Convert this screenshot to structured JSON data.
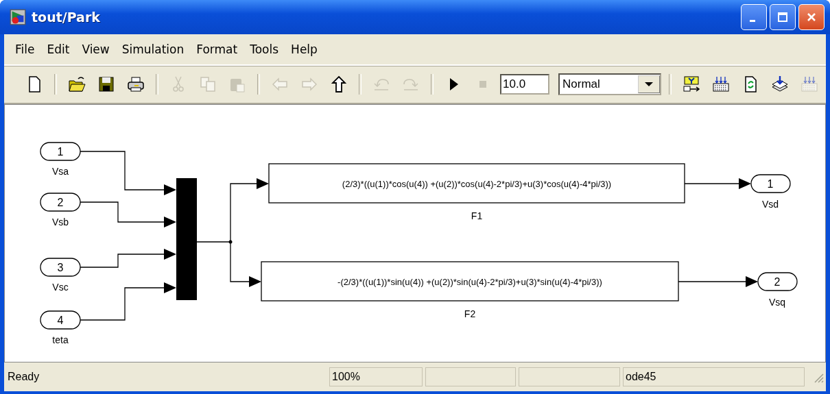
{
  "window": {
    "title": "tout/Park"
  },
  "menu": [
    "File",
    "Edit",
    "View",
    "Simulation",
    "Format",
    "Tools",
    "Help"
  ],
  "toolbar": [
    {
      "kind": "new",
      "disabled": false
    },
    {
      "kind": "separator"
    },
    {
      "kind": "open",
      "disabled": false
    },
    {
      "kind": "save",
      "disabled": false
    },
    {
      "kind": "print",
      "disabled": false
    },
    {
      "kind": "separator"
    },
    {
      "kind": "cut",
      "disabled": true
    },
    {
      "kind": "copy",
      "disabled": true
    },
    {
      "kind": "paste",
      "disabled": true
    },
    {
      "kind": "separator"
    },
    {
      "kind": "back",
      "disabled": true
    },
    {
      "kind": "forward",
      "disabled": true
    },
    {
      "kind": "up",
      "disabled": false
    },
    {
      "kind": "separator"
    },
    {
      "kind": "undo",
      "disabled": true
    },
    {
      "kind": "redo",
      "disabled": true
    },
    {
      "kind": "separator"
    },
    {
      "kind": "start",
      "disabled": false
    },
    {
      "kind": "stop",
      "disabled": true
    },
    {
      "kind": "stoptime",
      "value": "10.0"
    },
    {
      "kind": "mode",
      "value": "Normal"
    },
    {
      "kind": "separator"
    },
    {
      "kind": "scope",
      "disabled": false
    },
    {
      "kind": "grid",
      "disabled": false
    },
    {
      "kind": "refresh",
      "disabled": false
    },
    {
      "kind": "layers",
      "disabled": false
    },
    {
      "kind": "grid",
      "disabled": true
    }
  ],
  "diagram": {
    "inports": [
      {
        "number": "1",
        "label": "Vsa"
      },
      {
        "number": "2",
        "label": "Vsb"
      },
      {
        "number": "3",
        "label": "Vsc"
      },
      {
        "number": "4",
        "label": "teta"
      }
    ],
    "functions": [
      {
        "expression": "(2/3)*((u(1))*cos(u(4)) +(u(2))*cos(u(4)-2*pi/3)+u(3)*cos(u(4)-4*pi/3))",
        "label": "F1"
      },
      {
        "expression": "-(2/3)*((u(1))*sin(u(4)) +(u(2))*sin(u(4)-2*pi/3)+u(3)*sin(u(4)-4*pi/3))",
        "label": "F2"
      }
    ],
    "outports": [
      {
        "number": "1",
        "label": "Vsd"
      },
      {
        "number": "2",
        "label": "Vsq"
      }
    ]
  },
  "status_bar": {
    "status": "Ready",
    "zoom": "100%",
    "solver": "ode45"
  }
}
